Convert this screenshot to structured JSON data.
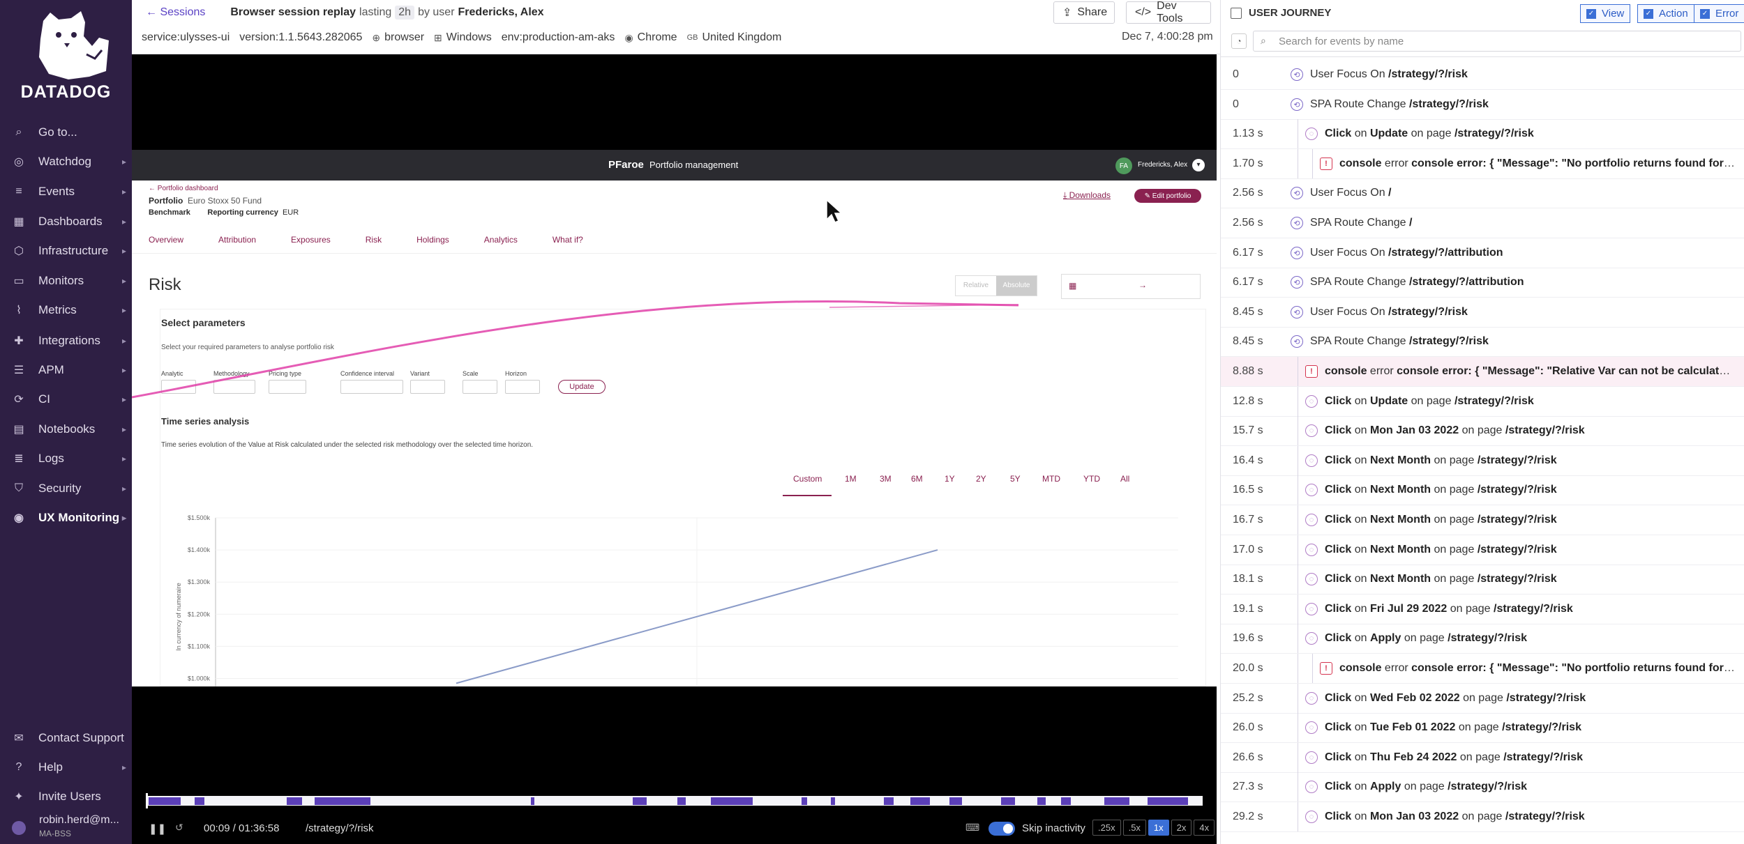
{
  "brand": "DATADOG",
  "nav": [
    {
      "label": "Go to...",
      "icon": "search-icon"
    },
    {
      "label": "Watchdog",
      "icon": "binoculars-icon"
    },
    {
      "label": "Events",
      "icon": "events-icon"
    },
    {
      "label": "Dashboards",
      "icon": "dashboard-icon"
    },
    {
      "label": "Infrastructure",
      "icon": "infrastructure-icon"
    },
    {
      "label": "Monitors",
      "icon": "monitor-icon"
    },
    {
      "label": "Metrics",
      "icon": "metrics-icon"
    },
    {
      "label": "Integrations",
      "icon": "puzzle-icon"
    },
    {
      "label": "APM",
      "icon": "apm-icon"
    },
    {
      "label": "CI",
      "icon": "ci-icon"
    },
    {
      "label": "Notebooks",
      "icon": "notebook-icon"
    },
    {
      "label": "Logs",
      "icon": "logs-icon"
    },
    {
      "label": "Security",
      "icon": "shield-icon"
    },
    {
      "label": "UX Monitoring",
      "icon": "ux-icon"
    }
  ],
  "nav_bottom": [
    {
      "label": "Contact Support",
      "icon": "chat-icon"
    },
    {
      "label": "Help",
      "icon": "help-icon"
    },
    {
      "label": "Invite Users",
      "icon": "invite-icon"
    }
  ],
  "user": {
    "name": "robin.herd@m...",
    "org": "MA-BSS"
  },
  "header": {
    "back_label": "Sessions",
    "title_prefix": "Browser session replay",
    "lasting": "lasting",
    "duration": "2h",
    "by_user": "by user",
    "user": "Fredericks, Alex",
    "share_label": "Share",
    "devtools_label": "Dev Tools",
    "timestamp": "Dec 7, 4:00:28 pm",
    "tags": [
      {
        "label": "service:ulysses-ui"
      },
      {
        "label": "version:1.1.5643.282065"
      },
      {
        "label": "browser"
      },
      {
        "label": "Windows"
      },
      {
        "label": "env:production-am-aks"
      },
      {
        "label": "Chrome"
      },
      {
        "label": "United Kingdom",
        "prefix": "GB"
      }
    ]
  },
  "replay": {
    "brand_name": "PFaroe",
    "brand_suffix": "Portfolio management",
    "user_initials": "FA",
    "user_name": "Fredericks, Alex",
    "back_link": "Portfolio dashboard",
    "portfolio_label": "Portfolio",
    "portfolio_name": "Euro Stoxx 50 Fund",
    "benchmark_label": "Benchmark",
    "currency_label": "Reporting currency",
    "currency": "EUR",
    "downloads": "Downloads",
    "edit_button": "Edit portfolio",
    "tabs": [
      "Overview",
      "Attribution",
      "Exposures",
      "Risk",
      "Holdings",
      "Analytics",
      "What if?"
    ],
    "page_title": "Risk",
    "toggle": [
      "Relative",
      "Absolute"
    ],
    "select_params_title": "Select parameters",
    "select_params_sub": "Select your required parameters to analyse portfolio risk",
    "params": [
      "Analytic",
      "Methodology",
      "Pricing type",
      "Confidence interval",
      "Variant",
      "Scale",
      "Horizon"
    ],
    "update_button": "Update",
    "ts_title": "Time series analysis",
    "ts_sub": "Time series evolution of the Value at Risk calculated under the selected risk methodology over the selected time horizon.",
    "ranges": [
      "Custom",
      "1M",
      "3M",
      "6M",
      "1Y",
      "2Y",
      "5Y",
      "MTD",
      "YTD",
      "All"
    ],
    "y_axis_label": "In currency of numeraire",
    "y_ticks": [
      "$1.500k",
      "$1.400k",
      "$1.300k",
      "$1.200k",
      "$1.100k",
      "$1.000k"
    ]
  },
  "chart_data": {
    "type": "line",
    "ylabel": "In currency of numeraire",
    "yticks": [
      "$1.500k",
      "$1.400k",
      "$1.300k",
      "$1.200k",
      "$1.100k",
      "$1.000k"
    ],
    "series": [
      {
        "points": [
          [
            0.25,
            985
          ],
          [
            0.75,
            1400
          ]
        ]
      }
    ]
  },
  "controls": {
    "time": "00:09 / 01:36:58",
    "path": "/strategy/?/risk",
    "skip_label": "Skip inactivity",
    "speeds": [
      ".25x",
      ".5x",
      "1x",
      "2x",
      "4x"
    ],
    "active_speed": "1x"
  },
  "journey": {
    "title": "USER JOURNEY",
    "filters": [
      "View",
      "Action",
      "Error"
    ],
    "search_placeholder": "Search for events by name",
    "rows": [
      {
        "t": "0",
        "kind": "view",
        "verb": "User Focus On",
        "obj": "/strategy/?/risk"
      },
      {
        "t": "0",
        "kind": "view",
        "verb": "SPA Route Change",
        "obj": "/strategy/?/risk"
      },
      {
        "t": "1.13 s",
        "kind": "action",
        "indent": 1,
        "pre": "Click",
        "mid": "on",
        "obj": "Update",
        "post": "on page",
        "page": "/strategy/?/risk"
      },
      {
        "t": "1.70 s",
        "kind": "error",
        "indent": 2,
        "pre": "console",
        "mid": "error",
        "obj": "console error: { \"Message\": \"No portfolio returns found for p..."
      },
      {
        "t": "2.56 s",
        "kind": "view",
        "verb": "User Focus On",
        "obj": "/"
      },
      {
        "t": "2.56 s",
        "kind": "view",
        "verb": "SPA Route Change",
        "obj": "/"
      },
      {
        "t": "6.17 s",
        "kind": "view",
        "verb": "User Focus On",
        "obj": "/strategy/?/attribution"
      },
      {
        "t": "6.17 s",
        "kind": "view",
        "verb": "SPA Route Change",
        "obj": "/strategy/?/attribution"
      },
      {
        "t": "8.45 s",
        "kind": "view",
        "verb": "User Focus On",
        "obj": "/strategy/?/risk"
      },
      {
        "t": "8.45 s",
        "kind": "view",
        "verb": "SPA Route Change",
        "obj": "/strategy/?/risk"
      },
      {
        "t": "8.88 s",
        "kind": "error",
        "indent": 1,
        "hl": true,
        "pre": "console",
        "mid": "error",
        "obj": "console error: { \"Message\": \"Relative Var can not be calculated ..."
      },
      {
        "t": "12.8 s",
        "kind": "action",
        "indent": 1,
        "pre": "Click",
        "mid": "on",
        "obj": "Update",
        "post": "on page",
        "page": "/strategy/?/risk"
      },
      {
        "t": "15.7 s",
        "kind": "action",
        "indent": 1,
        "pre": "Click",
        "mid": "on",
        "obj": "Mon Jan 03 2022",
        "post": "on page",
        "page": "/strategy/?/risk"
      },
      {
        "t": "16.4 s",
        "kind": "action",
        "indent": 1,
        "pre": "Click",
        "mid": "on",
        "obj": "Next Month",
        "post": "on page",
        "page": "/strategy/?/risk"
      },
      {
        "t": "16.5 s",
        "kind": "action",
        "indent": 1,
        "pre": "Click",
        "mid": "on",
        "obj": "Next Month",
        "post": "on page",
        "page": "/strategy/?/risk"
      },
      {
        "t": "16.7 s",
        "kind": "action",
        "indent": 1,
        "pre": "Click",
        "mid": "on",
        "obj": "Next Month",
        "post": "on page",
        "page": "/strategy/?/risk"
      },
      {
        "t": "17.0 s",
        "kind": "action",
        "indent": 1,
        "pre": "Click",
        "mid": "on",
        "obj": "Next Month",
        "post": "on page",
        "page": "/strategy/?/risk"
      },
      {
        "t": "18.1 s",
        "kind": "action",
        "indent": 1,
        "pre": "Click",
        "mid": "on",
        "obj": "Next Month",
        "post": "on page",
        "page": "/strategy/?/risk"
      },
      {
        "t": "19.1 s",
        "kind": "action",
        "indent": 1,
        "pre": "Click",
        "mid": "on",
        "obj": "Fri Jul 29 2022",
        "post": "on page",
        "page": "/strategy/?/risk"
      },
      {
        "t": "19.6 s",
        "kind": "action",
        "indent": 1,
        "pre": "Click",
        "mid": "on",
        "obj": "Apply",
        "post": "on page",
        "page": "/strategy/?/risk"
      },
      {
        "t": "20.0 s",
        "kind": "error",
        "indent": 2,
        "pre": "console",
        "mid": "error",
        "obj": "console error: { \"Message\": \"No portfolio returns found for p..."
      },
      {
        "t": "25.2 s",
        "kind": "action",
        "indent": 1,
        "pre": "Click",
        "mid": "on",
        "obj": "Wed Feb 02 2022",
        "post": "on page",
        "page": "/strategy/?/risk"
      },
      {
        "t": "26.0 s",
        "kind": "action",
        "indent": 1,
        "pre": "Click",
        "mid": "on",
        "obj": "Tue Feb 01 2022",
        "post": "on page",
        "page": "/strategy/?/risk"
      },
      {
        "t": "26.6 s",
        "kind": "action",
        "indent": 1,
        "pre": "Click",
        "mid": "on",
        "obj": "Thu Feb 24 2022",
        "post": "on page",
        "page": "/strategy/?/risk"
      },
      {
        "t": "27.3 s",
        "kind": "action",
        "indent": 1,
        "pre": "Click",
        "mid": "on",
        "obj": "Apply",
        "post": "on page",
        "page": "/strategy/?/risk"
      },
      {
        "t": "29.2 s",
        "kind": "action",
        "indent": 1,
        "pre": "Click",
        "mid": "on",
        "obj": "Mon Jan 03 2022",
        "post": "on page",
        "page": "/strategy/?/risk"
      }
    ]
  },
  "colors": {
    "sidebar": "#2e1f44",
    "accent": "#3b6fd6",
    "pfaroe": "#8a2150",
    "error": "#d4344f",
    "action": "#b07cc6",
    "view": "#7c68c8"
  }
}
